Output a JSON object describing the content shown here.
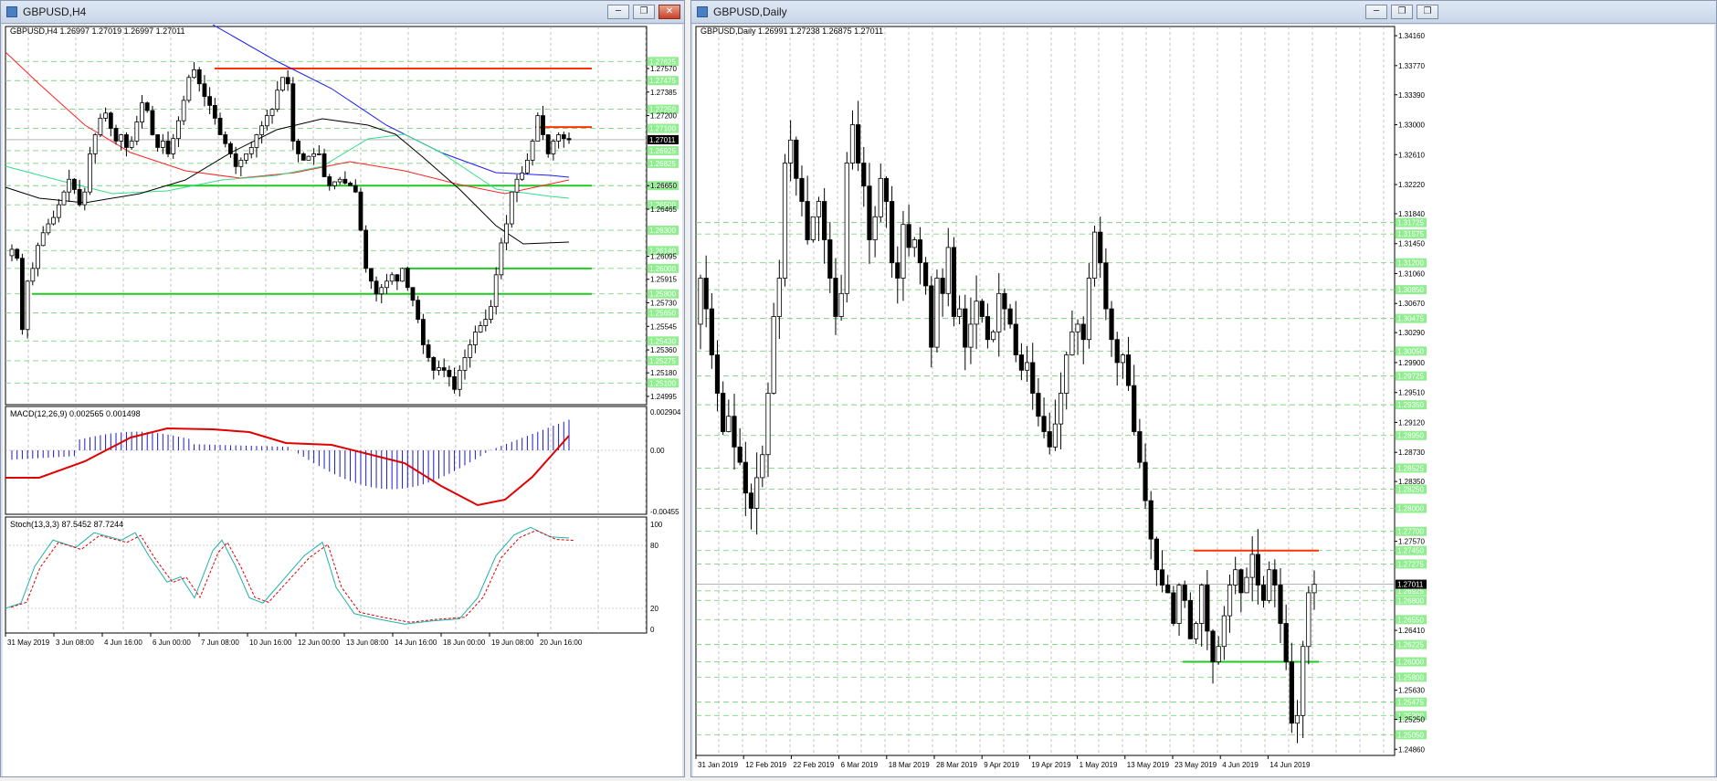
{
  "left": {
    "window_title": "GBPUSD,H4",
    "info": "GBPUSD,H4  1.26997 1.27019 1.26997 1.27011",
    "price_axis": [
      "1.27570",
      "1.27385",
      "1.27200",
      "1.26650",
      "1.26465",
      "1.26095",
      "1.25915",
      "1.25730",
      "1.25545",
      "1.25360",
      "1.25180",
      "1.24995"
    ],
    "green_tags": [
      "1.27625",
      "1.27475",
      "1.27250",
      "1.27100",
      "1.26925",
      "1.26825",
      "1.26650",
      "1.26500",
      "1.26300",
      "1.26140",
      "1.26000",
      "1.25800",
      "1.25650",
      "1.25430",
      "1.25275",
      "1.25100"
    ],
    "current_price": "1.27011",
    "time_axis": [
      "31 May 2019",
      "3 Jun 08:00",
      "4 Jun 16:00",
      "6 Jun 00:00",
      "7 Jun 08:00",
      "10 Jun 16:00",
      "12 Jun 00:00",
      "13 Jun 08:00",
      "14 Jun 16:00",
      "18 Jun 00:00",
      "19 Jun 08:00",
      "20 Jun 16:00"
    ],
    "macd_label": "MACD(12,26,9) 0.002565 0.001498",
    "macd_axis": [
      "0.002904",
      "0.00",
      "-0.00455"
    ],
    "stoch_label": "Stoch(13,3,3) 87.5452 87.7244",
    "stoch_axis": [
      "100",
      "80",
      "20",
      "0"
    ]
  },
  "right": {
    "window_title": "GBPUSD,Daily",
    "info": "GBPUSD,Daily  1.26991 1.27238 1.26875 1.27011",
    "price_axis": [
      "1.34160",
      "1.33770",
      "1.33390",
      "1.33000",
      "1.32610",
      "1.32220",
      "1.31840",
      "1.31450",
      "1.31060",
      "1.30670",
      "1.30290",
      "1.29900",
      "1.29510",
      "1.29120",
      "1.28730",
      "1.28350",
      "1.27570",
      "1.26410",
      "1.25630",
      "1.25250",
      "1.24860"
    ],
    "green_tags": [
      "1.31725",
      "1.31575",
      "1.31200",
      "1.30850",
      "1.30475",
      "1.30050",
      "1.29725",
      "1.29350",
      "1.28950",
      "1.28525",
      "1.28250",
      "1.28000",
      "1.27700",
      "1.27450",
      "1.27275",
      "1.26925",
      "1.26800",
      "1.26550",
      "1.26225",
      "1.26000",
      "1.25800",
      "1.25475",
      "1.25300",
      "1.25050"
    ],
    "current_price": "1.27011",
    "time_axis": [
      "31 Jan 2019",
      "12 Feb 2019",
      "22 Feb 2019",
      "6 Mar 2019",
      "18 Mar 2019",
      "28 Mar 2019",
      "9 Apr 2019",
      "19 Apr 2019",
      "1 May 2019",
      "13 May 2019",
      "23 May 2019",
      "4 Jun 2019",
      "14 Jun 2019"
    ]
  },
  "buttons": {
    "minimize": "─",
    "restore": "❐",
    "close": "✕"
  }
}
